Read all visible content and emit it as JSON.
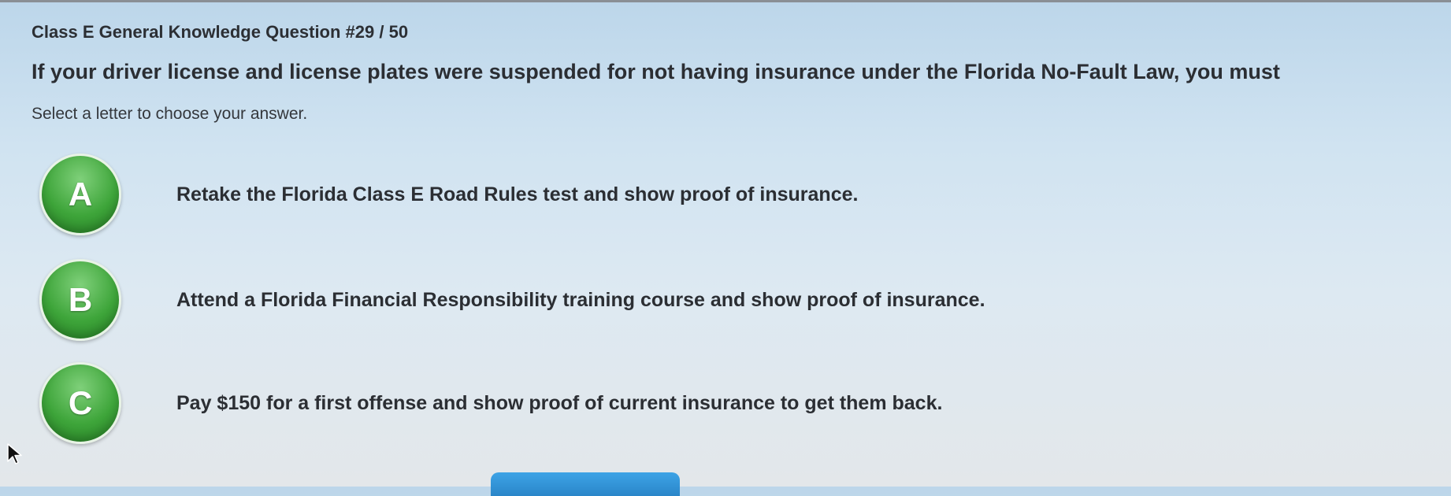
{
  "quiz": {
    "header": "Class E General Knowledge Question #29 / 50",
    "question": "If your driver license and license plates were suspended for not having insurance under the Florida No-Fault Law, you must",
    "instruction": "Select a letter to choose your answer.",
    "options": [
      {
        "letter": "A",
        "text": "Retake the Florida Class E Road Rules test and show proof of insurance."
      },
      {
        "letter": "B",
        "text": "Attend a Florida Financial Responsibility training course and show proof of insurance."
      },
      {
        "letter": "C",
        "text": "Pay $150 for a first offense and show proof of current insurance to get them back."
      }
    ]
  },
  "colors": {
    "option_button": "#3ea53a",
    "next_button": "#2a86c9"
  },
  "icons": {
    "pointer": "mouse-pointer-icon"
  }
}
